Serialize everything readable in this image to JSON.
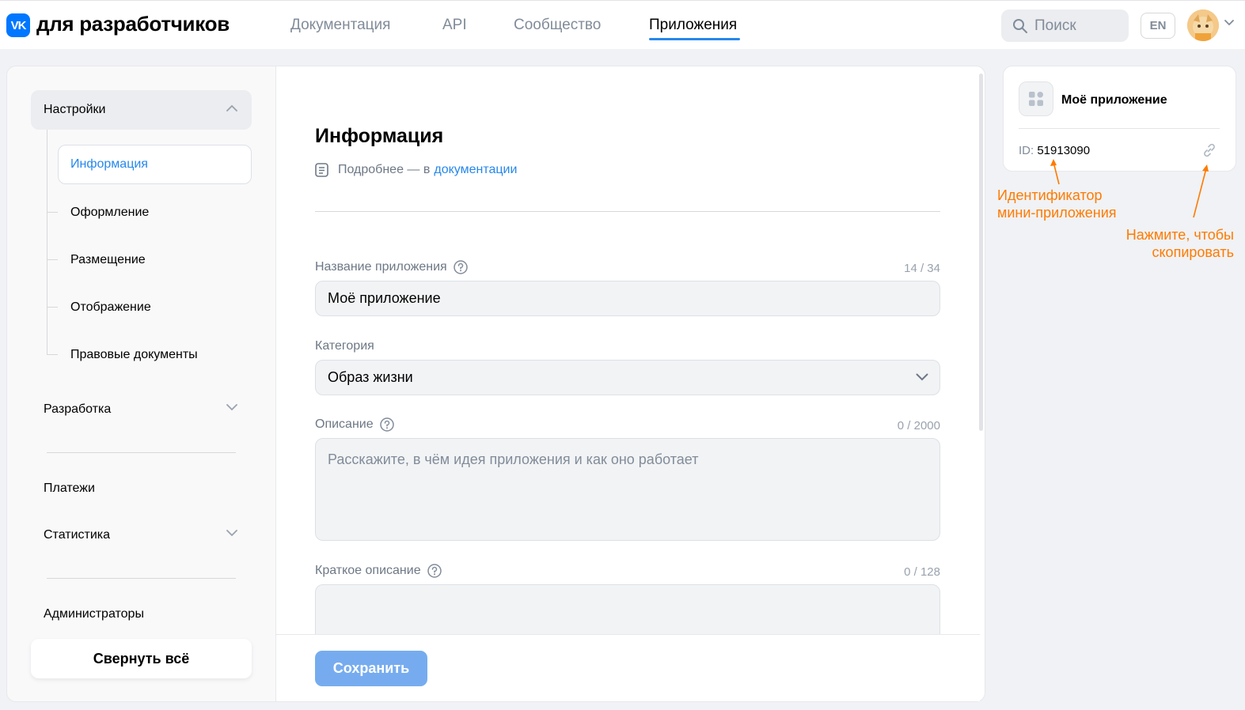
{
  "header": {
    "logo_text": "VK",
    "brand": "для разработчиков",
    "nav": [
      {
        "label": "Документация"
      },
      {
        "label": "API"
      },
      {
        "label": "Сообщество"
      },
      {
        "label": "Приложения",
        "active": true
      }
    ],
    "search_placeholder": "Поиск",
    "lang": "EN"
  },
  "sidebar": {
    "settings": "Настройки",
    "settings_items": [
      "Информация",
      "Оформление",
      "Размещение",
      "Отображение",
      "Правовые документы"
    ],
    "development": "Разработка",
    "payments": "Платежи",
    "statistics": "Статистика",
    "admins": "Администраторы",
    "collapse_all": "Свернуть всё"
  },
  "main": {
    "title": "Информация",
    "doc_prefix": "Подробнее — в",
    "doc_link": "документации",
    "name_label": "Название приложения",
    "name_counter": "14 / 34",
    "name_value": "Моё приложение",
    "category_label": "Категория",
    "category_value": "Образ жизни",
    "description_label": "Описание",
    "description_counter": "0 / 2000",
    "description_placeholder": "Расскажите, в чём идея приложения и как оно работает",
    "short_label": "Краткое описание",
    "short_counter": "0 / 128",
    "save_label": "Сохранить"
  },
  "card": {
    "app_name": "Моё приложение",
    "id_label": "ID:",
    "id_value": "51913090"
  },
  "annotations": {
    "id_note_line1": "Идентификатор",
    "id_note_line2": "мини-приложения",
    "copy_note_line1": "Нажмите, чтобы",
    "copy_note_line2": "скопировать"
  },
  "colors": {
    "accent": "#2688eb",
    "annotation": "#ff7a00",
    "save_button": "#76acef"
  }
}
